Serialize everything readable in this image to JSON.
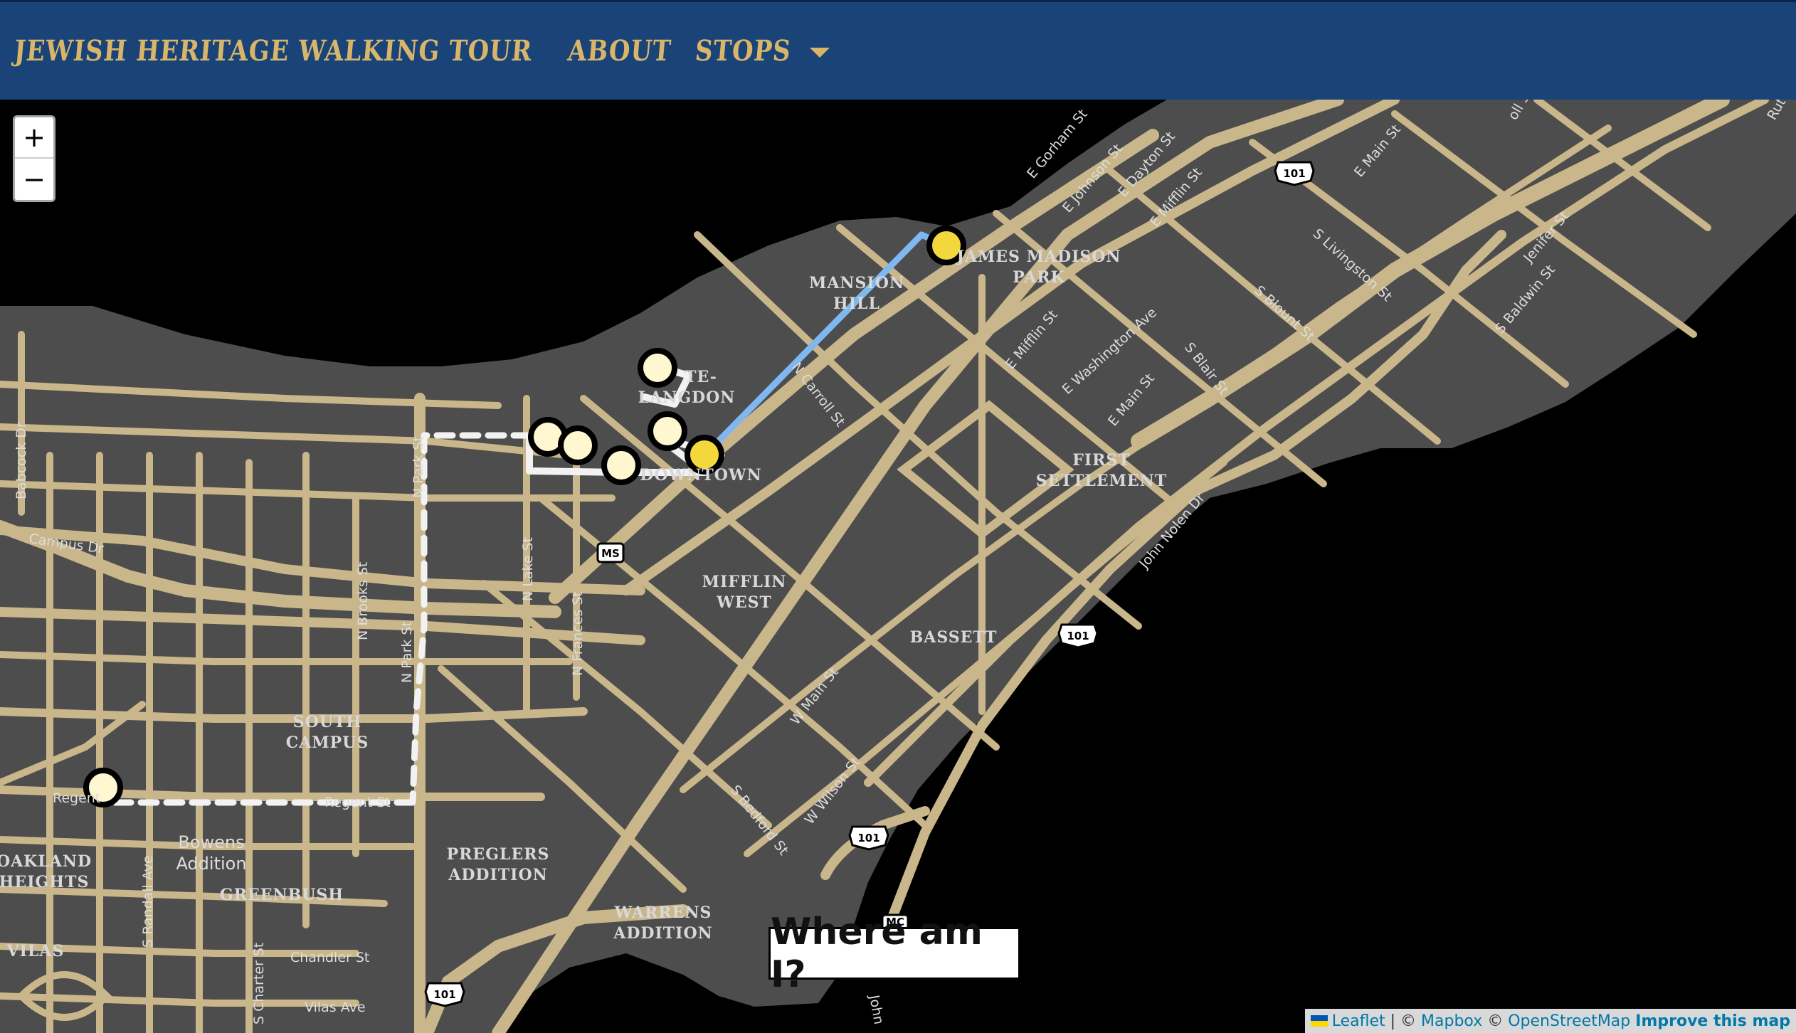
{
  "navbar": {
    "brand": "Jewish Heritage Walking Tour",
    "links": [
      "About",
      "Stops"
    ],
    "bg_color": "#1a4478",
    "text_color": "#d9b56a"
  },
  "map": {
    "zoom_in": "+",
    "zoom_out": "−",
    "where_button": "Where am I?",
    "attribution": {
      "leaflet": "Leaflet",
      "sep1": " | © ",
      "mapbox": "Mapbox",
      "sep2": " © ",
      "osm": "OpenStreetMap",
      "improve": "Improve this map"
    },
    "colors": {
      "land": "#4d4d4d",
      "water": "#000000",
      "roads": "#c9b68a",
      "active_marker": "#f2d83a",
      "visited_marker": "#fff7d0",
      "route_active": "#7fb8f0",
      "route_walked": "#f2f2f2"
    },
    "neighborhoods": {
      "james_madison_park_1": "JAMES MADISON",
      "james_madison_park_2": "PARK",
      "mansion_hill_1": "MANSION",
      "mansion_hill_2": "HILL",
      "langdon_1": "TE-",
      "langdon_2": "LANGDON",
      "downtown": "DOWNTOWN",
      "first_settlement_1": "FIRST",
      "first_settlement_2": "SETTLEMENT",
      "mifflin_west_1": "MIFFLIN",
      "mifflin_west_2": "WEST",
      "bassett": "BASSETT",
      "south_campus_1": "SOUTH",
      "south_campus_2": "CAMPUS",
      "preglers_1": "PREGLERS",
      "preglers_2": "ADDITION",
      "warrens_1": "WARRENS",
      "warrens_2": "ADDITION",
      "oakland_1": "OAKLAND",
      "oakland_2": "HEIGHTS",
      "greenbush": "GREENBUSH",
      "vilas": "VILAS",
      "bowens_1": "Bowens",
      "bowens_2": "Addition"
    },
    "streets": {
      "e_gorham": "E Gorham St",
      "e_johnson": "E Johnson St",
      "e_dayton": "E Dayton St",
      "e_mifflin_top": "E Mifflin St",
      "e_main_top": "E Main St",
      "s_livingston": "S Livingston St",
      "s_blount": "S Blount St",
      "jenifer": "Jenifer St",
      "s_baldwin": "S Baldwin St",
      "e_mifflin": "E Mifflin St",
      "e_washington": "E Washington Ave",
      "e_main": "E Main St",
      "s_blair": "S Blair St",
      "john_nolen": "John Nolen Dr",
      "n_carroll": "N Carroll St",
      "babcock": "Babcock Dr",
      "campus": "Campus Dr",
      "n_lake": "N Lake St",
      "n_park_top": "N Park St",
      "n_brooks": "N Brooks St",
      "n_park": "N Park St",
      "n_frances": "N Frances St",
      "w_main": "W Main St",
      "w_wilson": "W Wilson St",
      "s_bedford": "S Bedford St",
      "regent_left": "Regent",
      "regent_st": "Regent St",
      "s_randall": "S Randall Ave",
      "s_charter": "S Charter St",
      "chandler": "Chandler St",
      "vilas_ave": "Vilas Ave",
      "rut": "Rut",
      "oll": "oll St",
      "john": "John"
    },
    "shields": {
      "us151_a": "101",
      "us151_b": "101",
      "us151_c": "101",
      "us151_d": "101",
      "ms": "MS",
      "mc": "MC"
    }
  }
}
